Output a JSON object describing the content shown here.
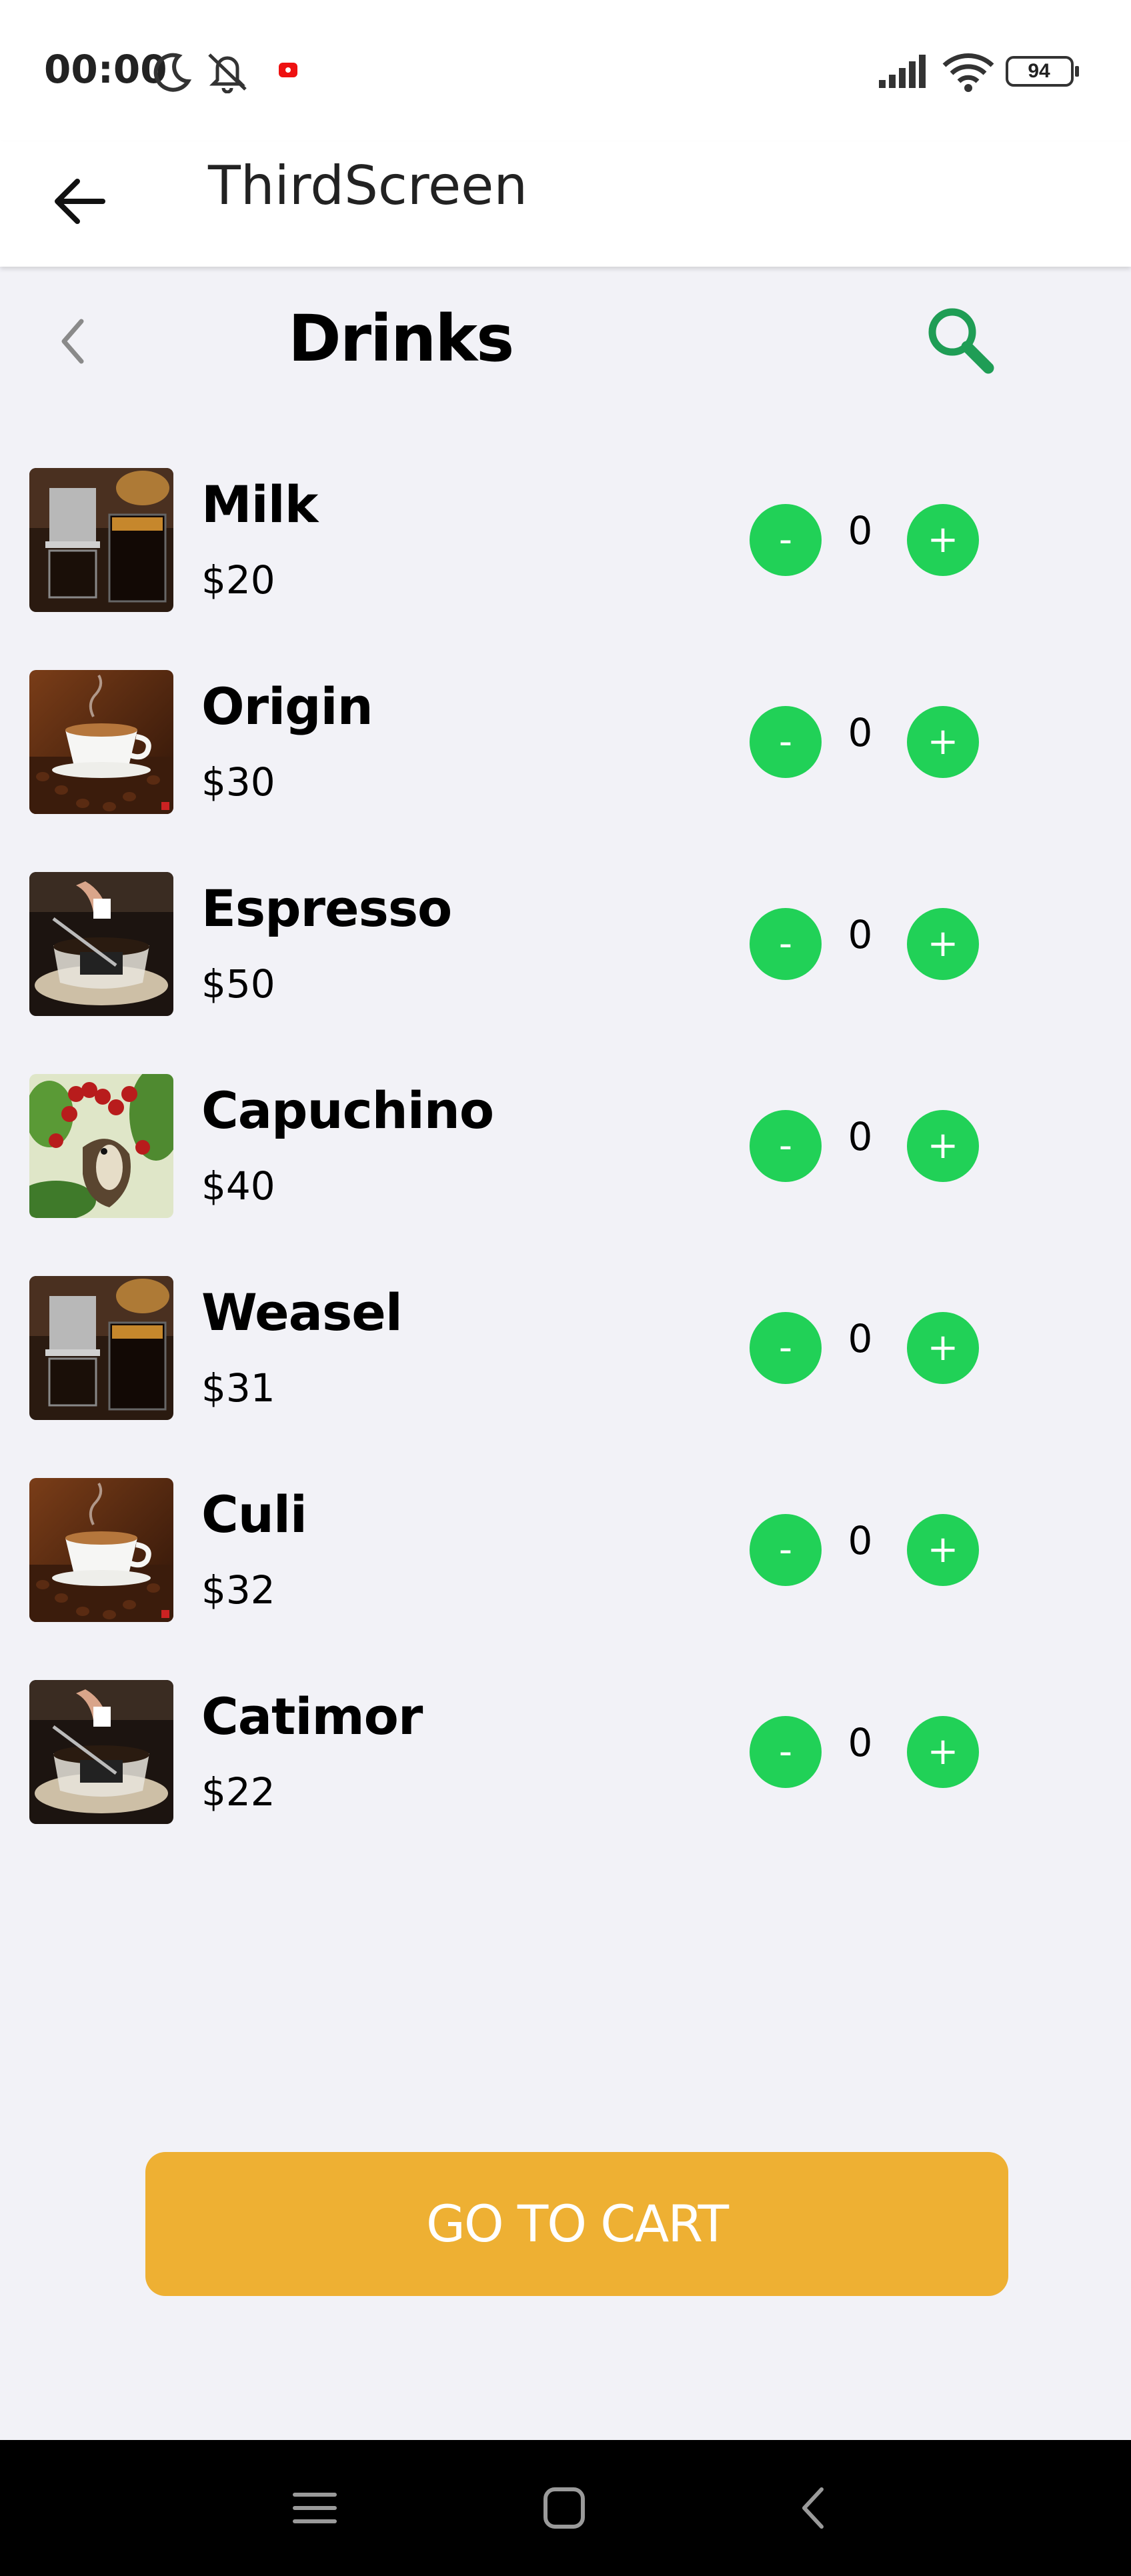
{
  "status_bar": {
    "time": "00:00",
    "battery": "94",
    "icons": [
      "moon-icon",
      "notifications-off-icon",
      "recording-dot-icon",
      "signal-icon",
      "wifi-icon",
      "battery-icon"
    ]
  },
  "app_bar": {
    "title": "ThirdScreen",
    "back_icon": "arrow-left-icon"
  },
  "header": {
    "title": "Drinks",
    "back_icon": "chevron-left-icon",
    "search_icon": "search-icon",
    "accent_color": "#1f9d55"
  },
  "items": [
    {
      "name": "Milk",
      "price": "$20",
      "quantity": "0",
      "image": "phin-coffee"
    },
    {
      "name": "Origin",
      "price": "$30",
      "quantity": "0",
      "image": "coffee-cup"
    },
    {
      "name": "Espresso",
      "price": "$50",
      "quantity": "0",
      "image": "sugar-coffee"
    },
    {
      "name": "Capuchino",
      "price": "$40",
      "quantity": "0",
      "image": "weasel-cherries"
    },
    {
      "name": "Weasel",
      "price": "$31",
      "quantity": "0",
      "image": "phin-coffee"
    },
    {
      "name": "Culi",
      "price": "$32",
      "quantity": "0",
      "image": "coffee-cup"
    },
    {
      "name": "Catimor",
      "price": "$22",
      "quantity": "0",
      "image": "sugar-coffee"
    }
  ],
  "controls": {
    "minus_label": "-",
    "plus_label": "+",
    "button_color": "#21d157"
  },
  "cart_button": {
    "label": "GO TO CART",
    "color": "#eeb033"
  },
  "nav_bar": {
    "icons": [
      "menu-icon",
      "home-square-icon",
      "back-chevron-icon"
    ]
  }
}
